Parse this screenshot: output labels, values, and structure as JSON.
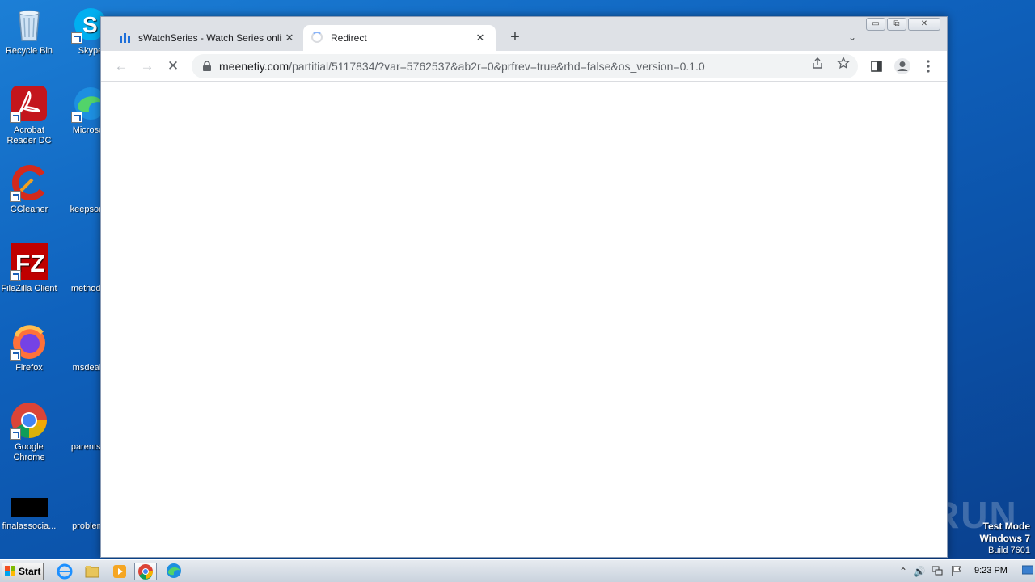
{
  "desktop": {
    "icons": [
      {
        "label": "Recycle Bin"
      },
      {
        "label": "Skype"
      },
      {
        "label": "Acrobat Reader DC"
      },
      {
        "label": "Microsoft"
      },
      {
        "label": "CCleaner"
      },
      {
        "label": "keepsome"
      },
      {
        "label": "FileZilla Client"
      },
      {
        "label": "methodsp"
      },
      {
        "label": "Firefox"
      },
      {
        "label": "msdeal.p"
      },
      {
        "label": "Google Chrome"
      },
      {
        "label": "parentsca"
      },
      {
        "label": "finalassocia..."
      },
      {
        "label": "problemd"
      }
    ],
    "watermark": {
      "line1": "Test Mode",
      "line2": "Windows 7",
      "line3": "Build 7601"
    },
    "brand": "ANY RUN"
  },
  "browser": {
    "tabs": [
      {
        "title": "sWatchSeries - Watch Series online,",
        "close": "✕"
      },
      {
        "title": "Redirect",
        "close": "✕"
      }
    ],
    "new_tab": "+",
    "tab_menu": "⌄",
    "window_buttons": {
      "minimize": "▭",
      "restore": "⧉",
      "close": "✕"
    },
    "nav": {
      "back": "←",
      "forward": "→",
      "stop": "✕"
    },
    "address": {
      "host": "meenetiy.com",
      "path": "/partitial/5117834/?var=5762537&ab2r=0&prfrev=true&rhd=false&os_version=0.1.0"
    }
  },
  "taskbar": {
    "start_label": "Start",
    "clock": "9:23 PM"
  },
  "colors": {
    "desktop_blue": "#0f62bd",
    "chrome_frame": "#dee1e6",
    "accent": "#1a73e8"
  }
}
